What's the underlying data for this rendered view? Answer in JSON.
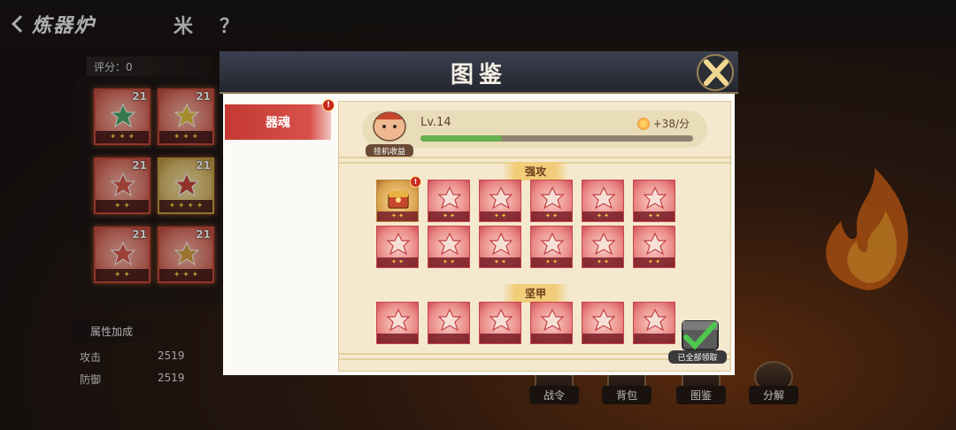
{
  "screen": {
    "title": "炼器炉",
    "score_label": "评分：0",
    "icons": {
      "a": "米",
      "b": "？"
    }
  },
  "inventory": [
    {
      "level": "21",
      "stars": "✦ ✦ ✦",
      "color": "#4aa86a",
      "frame": "red"
    },
    {
      "level": "21",
      "stars": "✦ ✦ ✦",
      "color": "#e6c040",
      "frame": "red"
    },
    {
      "level": "21",
      "stars": "✦ ✦",
      "color": "#d85a4a",
      "frame": "red"
    },
    {
      "level": "21",
      "stars": "✦ ✦ ✦ ✦",
      "color": "#c8463a",
      "frame": "gold"
    },
    {
      "level": "21",
      "stars": "✦ ✦",
      "color": "#d85a4a",
      "frame": "red"
    },
    {
      "level": "21",
      "stars": "✦ ✦ ✦",
      "color": "#d8a040",
      "frame": "red"
    }
  ],
  "attributes": {
    "title": "属性加成",
    "rows": [
      {
        "name": "攻击",
        "value": "2519"
      },
      {
        "name": "防御",
        "value": "2519"
      }
    ]
  },
  "bottom_nav": [
    {
      "label": "战令"
    },
    {
      "label": "背包"
    },
    {
      "label": "图鉴"
    },
    {
      "label": "分解"
    }
  ],
  "modal": {
    "title": "图鉴",
    "side_tabs": [
      {
        "label": "器魂",
        "badge": "!"
      }
    ],
    "idle": {
      "avatar_label": "挂机收益",
      "level": "Lv.14",
      "progress": 0.3,
      "rate": "+38/分"
    },
    "sections": [
      {
        "title": "强攻",
        "rows": [
          [
            {
              "kind": "chest",
              "stars": "✦ ✦",
              "badge": "!"
            },
            {
              "kind": "item",
              "stars": "✦ ✦"
            },
            {
              "kind": "item",
              "stars": "✦ ✦"
            },
            {
              "kind": "item",
              "stars": "✦ ✦"
            },
            {
              "kind": "item",
              "stars": "✦ ✦"
            },
            {
              "kind": "item",
              "stars": "✦ ✦"
            }
          ],
          [
            {
              "kind": "item",
              "stars": "✦ ✦"
            },
            {
              "kind": "item",
              "stars": "✦ ✦"
            },
            {
              "kind": "item",
              "stars": "✦ ✦"
            },
            {
              "kind": "item",
              "stars": "✦ ✦"
            },
            {
              "kind": "item",
              "stars": "✦ ✦"
            },
            {
              "kind": "item",
              "stars": "✦ ✦"
            }
          ]
        ]
      },
      {
        "title": "坚甲",
        "rows": [
          [
            {
              "kind": "item",
              "stars": ""
            },
            {
              "kind": "item",
              "stars": ""
            },
            {
              "kind": "item",
              "stars": ""
            },
            {
              "kind": "item",
              "stars": ""
            },
            {
              "kind": "item",
              "stars": ""
            },
            {
              "kind": "item",
              "stars": ""
            }
          ]
        ]
      }
    ],
    "claim_all_label": "已全部领取"
  }
}
